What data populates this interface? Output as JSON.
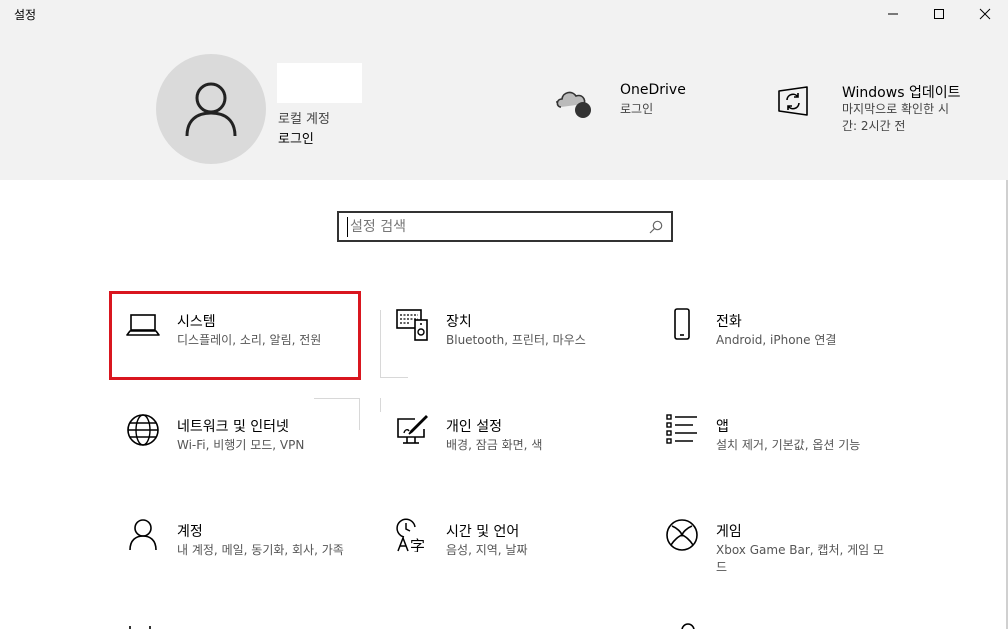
{
  "window": {
    "title": "설정"
  },
  "account": {
    "type": "로컬 계정",
    "login": "로그인"
  },
  "header_items": [
    {
      "id": "onedrive",
      "title": "OneDrive",
      "subtitle": "로그인",
      "icon": "cloud-icon"
    },
    {
      "id": "windows-update",
      "title": "Windows 업데이트",
      "subtitle": "마지막으로 확인한 시간: 2시간 전",
      "icon": "update-icon"
    }
  ],
  "search": {
    "placeholder": "설정 검색"
  },
  "tiles": [
    {
      "id": "system",
      "title": "시스템",
      "subtitle": "디스플레이, 소리, 알림, 전원",
      "icon": "laptop-icon",
      "highlighted": true
    },
    {
      "id": "devices",
      "title": "장치",
      "subtitle": "Bluetooth, 프린터, 마우스",
      "icon": "devices-icon"
    },
    {
      "id": "phone",
      "title": "전화",
      "subtitle": "Android, iPhone 연결",
      "icon": "phone-icon"
    },
    {
      "id": "network",
      "title": "네트워크 및 인터넷",
      "subtitle": "Wi-Fi, 비행기 모드, VPN",
      "icon": "globe-icon"
    },
    {
      "id": "personalization",
      "title": "개인 설정",
      "subtitle": "배경, 잠금 화면, 색",
      "icon": "personalization-icon"
    },
    {
      "id": "apps",
      "title": "앱",
      "subtitle": "설치 제거, 기본값, 옵션 기능",
      "icon": "apps-list-icon"
    },
    {
      "id": "accounts",
      "title": "계정",
      "subtitle": "내 계정, 메일, 동기화, 회사, 가족",
      "icon": "person-icon"
    },
    {
      "id": "time-language",
      "title": "시간 및 언어",
      "subtitle": "음성, 지역, 날짜",
      "icon": "time-language-icon"
    },
    {
      "id": "gaming",
      "title": "게임",
      "subtitle": "Xbox Game Bar, 캡처, 게임 모드",
      "icon": "xbox-icon"
    }
  ]
}
